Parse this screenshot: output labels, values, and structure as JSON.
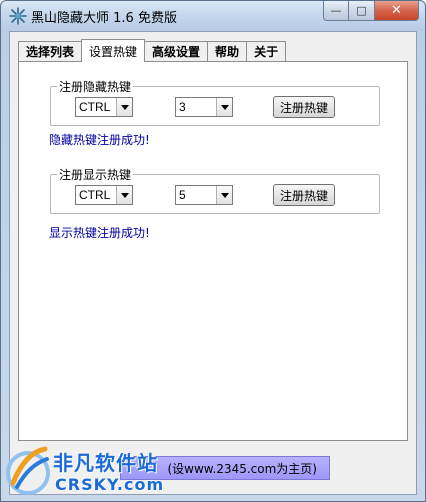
{
  "window": {
    "title": "黑山隐藏大师 1.6 免费版",
    "minimize_glyph": "—",
    "maximize_glyph": "□",
    "close_glyph": "✕"
  },
  "tabs": [
    {
      "label": "选择列表",
      "active": false
    },
    {
      "label": "设置热键",
      "active": true
    },
    {
      "label": "高级设置",
      "active": false
    },
    {
      "label": "帮助",
      "active": false
    },
    {
      "label": "关于",
      "active": false
    }
  ],
  "hide_hotkey": {
    "group_title": "注册隐藏热键",
    "modifier": "CTRL",
    "key": "3",
    "register_button": "注册热键",
    "status": "隐藏热键注册成功!"
  },
  "show_hotkey": {
    "group_title": "注册显示热键",
    "modifier": "CTRL",
    "key": "5",
    "register_button": "注册热键",
    "status": "显示热键注册成功!"
  },
  "homepage_button": "(设www.2345.com为主页)",
  "watermark": {
    "cn": "非凡软件站",
    "en": "CRSKY.com"
  },
  "colors": {
    "status_text": "#0000a0",
    "homepage_button": "#a7a3fb",
    "watermark": "#1a6ad8"
  }
}
